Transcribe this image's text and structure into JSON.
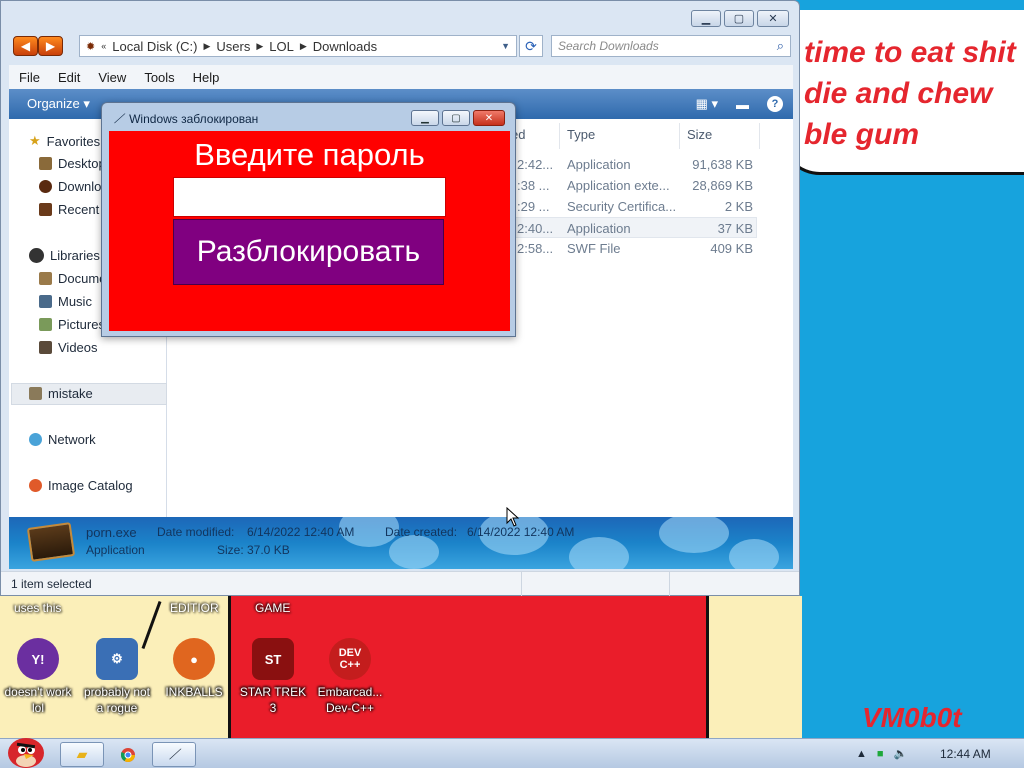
{
  "wallpaper": {
    "bubble_lines": [
      "time to eat shit",
      "die and chew",
      "ble gum"
    ],
    "signature": "VM0b0t",
    "top_labels": [
      "uses this",
      "EDITIOR",
      "GAME"
    ]
  },
  "desktop_icons": [
    {
      "label": "doesn't work lol",
      "icon": "yahoo-icon",
      "color": "#6b2fa0",
      "glyph": "Y!"
    },
    {
      "label": "probably not a rogue",
      "icon": "computer-gears-icon",
      "color": "#3a6fb5",
      "glyph": "⚙"
    },
    {
      "label": "INKBALLS",
      "icon": "inkball-icon",
      "color": "#e0661f",
      "glyph": "●"
    },
    {
      "label": "STAR TREK 3",
      "icon": "star-trek-icon",
      "color": "#8a1010",
      "glyph": "ST"
    },
    {
      "label": "Embarcad... Dev-C++",
      "icon": "dev-cpp-icon",
      "color": "#c41d1d",
      "glyph": "DEV C++"
    }
  ],
  "explorer": {
    "breadcrumb": [
      "Local Disk (C:)",
      "Users",
      "LOL",
      "Downloads"
    ],
    "search_placeholder": "Search Downloads",
    "menu": [
      "File",
      "Edit",
      "View",
      "Tools",
      "Help"
    ],
    "toolbar_organize": "Organize",
    "nav": {
      "favorites": "Favorites",
      "favorites_items": [
        "Desktop",
        "Downloads",
        "Recent Places"
      ],
      "libraries": "Libraries",
      "libraries_items": [
        "Documents",
        "Music",
        "Pictures",
        "Videos"
      ],
      "mistake": "mistake",
      "network": "Network",
      "image_catalog": "Image Catalog"
    },
    "columns": {
      "modified": "ed",
      "type": "Type",
      "size": "Size"
    },
    "files": [
      {
        "modified": "2:42...",
        "type": "Application",
        "size": "91,638 KB"
      },
      {
        "modified": ":38 ...",
        "type": "Application exte...",
        "size": "28,869 KB"
      },
      {
        "modified": ":29 ...",
        "type": "Security Certifica...",
        "size": "2 KB"
      },
      {
        "modified": "2:40...",
        "type": "Application",
        "size": "37 KB"
      },
      {
        "modified": "2:58...",
        "type": "SWF File",
        "size": "409 KB"
      }
    ],
    "details": {
      "name": "porn.exe",
      "kind": "Application",
      "modified_label": "Date modified:",
      "modified": "6/14/2022 12:40 AM",
      "created_label": "Date created:",
      "created": "6/14/2022 12:40 AM",
      "size_label": "Size:",
      "size": "37.0 KB"
    },
    "status": "1 item selected"
  },
  "lock_dialog": {
    "title": "Windows заблокирован",
    "heading": "Введите пароль",
    "password_value": "",
    "button": "Разблокировать"
  },
  "taskbar": {
    "clock": "12:44 AM"
  },
  "colors": {
    "lock_red": "#ff0000",
    "unlock_purple": "#800080",
    "desktop_blue": "#17a3dd"
  }
}
